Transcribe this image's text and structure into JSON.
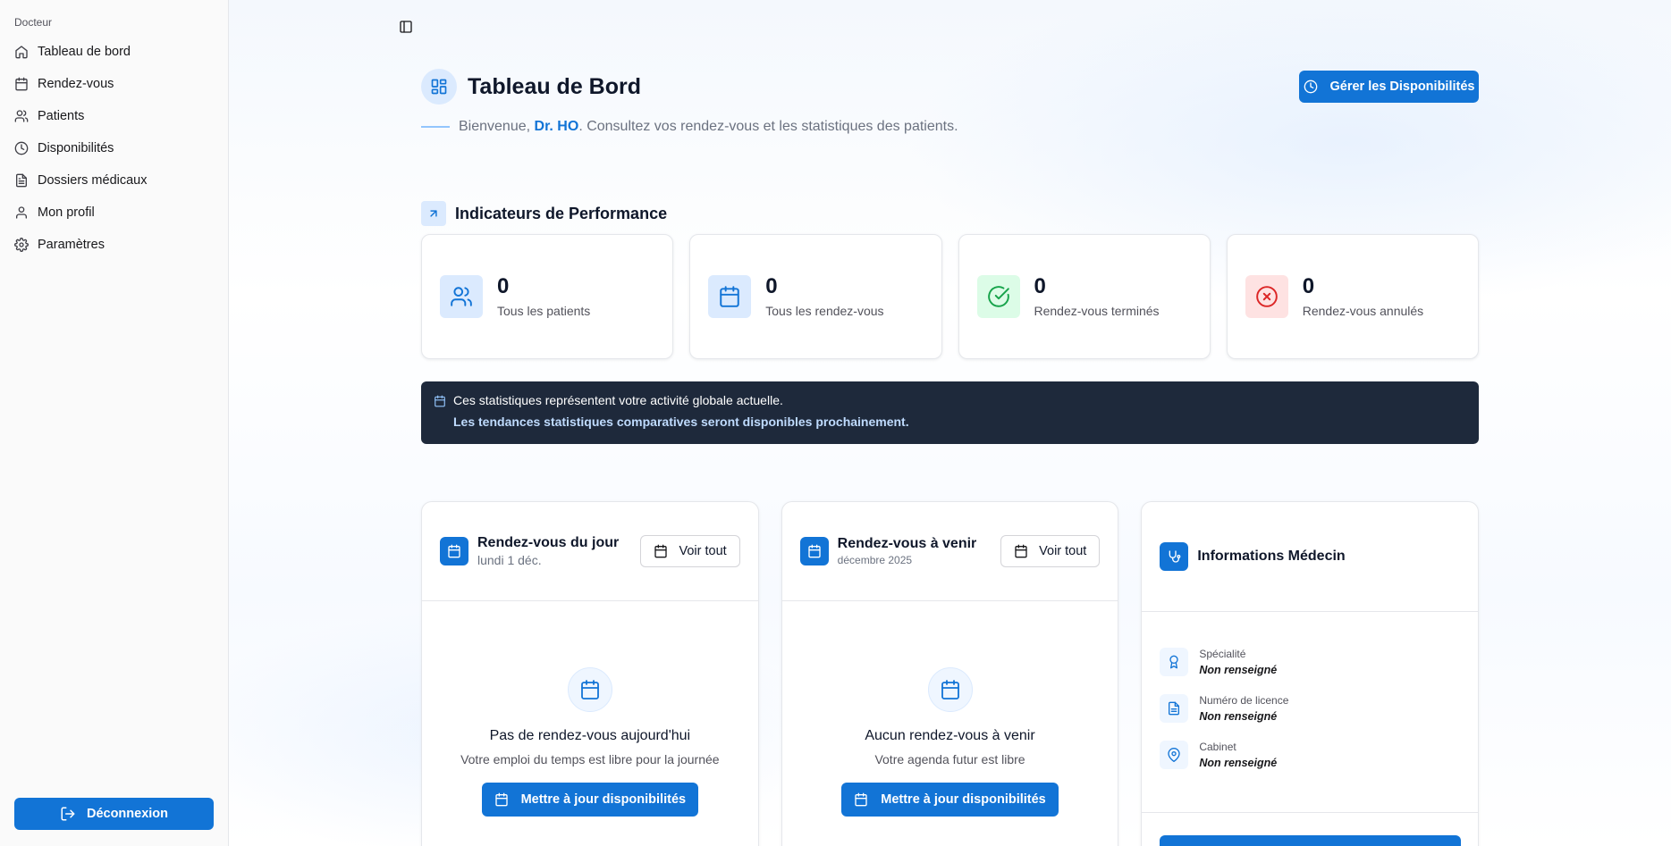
{
  "sidebar": {
    "group_label": "Docteur",
    "items": [
      {
        "label": "Tableau de bord",
        "icon": "home-icon"
      },
      {
        "label": "Rendez-vous",
        "icon": "calendar-icon"
      },
      {
        "label": "Patients",
        "icon": "users-icon"
      },
      {
        "label": "Disponibilités",
        "icon": "clock-icon"
      },
      {
        "label": "Dossiers médicaux",
        "icon": "file-text-icon"
      },
      {
        "label": "Mon profil",
        "icon": "user-icon"
      },
      {
        "label": "Paramètres",
        "icon": "gear-icon"
      }
    ],
    "logout_label": "Déconnexion"
  },
  "header": {
    "title": "Tableau de Bord",
    "welcome_prefix": "Bienvenue, ",
    "doctor_name": "Dr. HO",
    "welcome_suffix": ". Consultez vos rendez-vous et les statistiques des patients.",
    "manage_button": "Gérer les Disponibilités"
  },
  "kpi": {
    "section_title": "Indicateurs de Performance",
    "cards": [
      {
        "value": "0",
        "label": "Tous les patients",
        "icon": "users-icon",
        "bg": "#dbeafe",
        "color": "#1274d6"
      },
      {
        "value": "0",
        "label": "Tous les rendez-vous",
        "icon": "calendar-icon",
        "bg": "#dbeafe",
        "color": "#1274d6"
      },
      {
        "value": "0",
        "label": "Rendez-vous terminés",
        "icon": "check-circle-icon",
        "bg": "#dcfce7",
        "color": "#16a34a"
      },
      {
        "value": "0",
        "label": "Rendez-vous annulés",
        "icon": "x-circle-icon",
        "bg": "#fee2e2",
        "color": "#dc2626"
      }
    ]
  },
  "banner": {
    "line1": "Ces statistiques représentent votre activité globale actuelle.",
    "line2": "Les tendances statistiques comparatives seront disponibles prochainement."
  },
  "today": {
    "title": "Rendez-vous du jour",
    "subtitle": "lundi 1 déc.",
    "view_all": "Voir tout",
    "empty_title": "Pas de rendez-vous aujourd'hui",
    "empty_sub": "Votre emploi du temps est libre pour la journée",
    "update_button": "Mettre à jour disponibilités"
  },
  "upcoming": {
    "title": "Rendez-vous à venir",
    "subtitle": "décembre 2025",
    "view_all": "Voir tout",
    "empty_title": "Aucun rendez-vous à venir",
    "empty_sub": "Votre agenda futur est libre",
    "update_button": "Mettre à jour disponibilités"
  },
  "doctor_info": {
    "title": "Informations Médecin",
    "rows": [
      {
        "label": "Spécialité",
        "value": "Non renseigné",
        "icon": "award-icon"
      },
      {
        "label": "Numéro de licence",
        "value": "Non renseigné",
        "icon": "file-text-icon"
      },
      {
        "label": "Cabinet",
        "value": "Non renseigné",
        "icon": "map-pin-icon"
      }
    ]
  },
  "colors": {
    "primary": "#1274d6",
    "banner_bg": "#1e293b"
  }
}
